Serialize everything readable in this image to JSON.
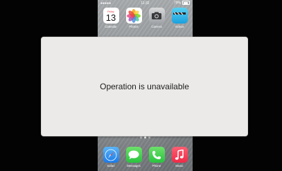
{
  "status_bar": {
    "carrier": "●●●●●",
    "time": "11:32",
    "battery": "79%"
  },
  "top_row": [
    {
      "label": "Calendar",
      "weekday": "Friday",
      "day": "13",
      "icon": "calendar-icon"
    },
    {
      "label": "Photos",
      "icon": "photos-icon"
    },
    {
      "label": "Camera",
      "icon": "camera-icon"
    },
    {
      "label": "Videos",
      "icon": "videos-icon"
    }
  ],
  "dock": [
    {
      "label": "Safari",
      "icon": "safari-icon"
    },
    {
      "label": "Messages",
      "icon": "messages-icon"
    },
    {
      "label": "Phone",
      "icon": "phone-icon"
    },
    {
      "label": "Music",
      "icon": "music-icon"
    }
  ],
  "page_dots": {
    "count": 3,
    "active": 1
  },
  "dialog": {
    "message": "Operation is unavailable"
  }
}
